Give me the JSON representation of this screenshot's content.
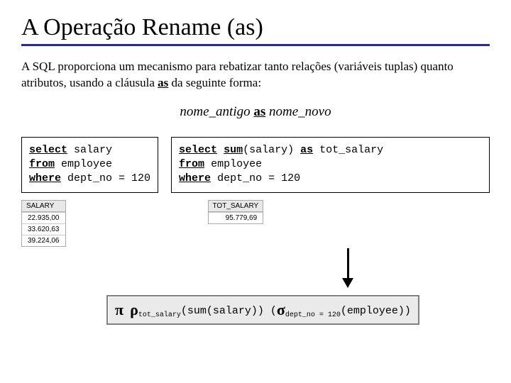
{
  "title": "A Operação Rename (as)",
  "intro_1": "A SQL proporciona um mecanismo para rebatizar tanto relações (variáveis tuplas) quanto atributos, usando a cláusula ",
  "intro_kw": "as",
  "intro_2": " da seguinte forma:",
  "syntax_old": "nome_antigo",
  "syntax_kw": "as",
  "syntax_new": "nome_novo",
  "left_code": {
    "l1a": "select",
    "l1b": " salary",
    "l2a": "from",
    "l2b": " employee",
    "l3a": "where",
    "l3b": " dept_no = 120"
  },
  "right_code": {
    "l1a": "select",
    "l1b": " ",
    "l1c": "sum",
    "l1d": "(salary) ",
    "l1e": "as",
    "l1f": " tot_salary",
    "l2a": "from",
    "l2b": " employee",
    "l3a": "where",
    "l3b": " dept_no = 120"
  },
  "table_left": {
    "header": "SALARY",
    "rows": [
      "22.935,00",
      "33.620,63",
      "39.224,06"
    ]
  },
  "table_right": {
    "header": "TOT_SALARY",
    "rows": [
      "95.779,69"
    ]
  },
  "formula": {
    "pi": "π",
    "rho": "ρ",
    "rho_sub": "tot_salary",
    "mid": "(sum(salary))",
    "sigma": "σ",
    "sigma_sub": "dept_no = 120",
    "tail": "(employee))"
  }
}
